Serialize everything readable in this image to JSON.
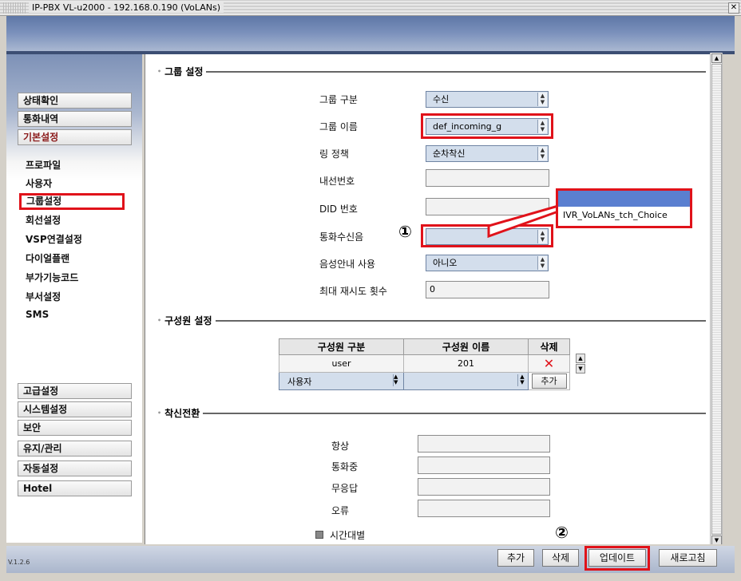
{
  "window": {
    "title": "IP-PBX VL-u2000 - 192.168.0.190 (VoLANs)",
    "close_glyph": "✕"
  },
  "sidebar": {
    "top_items": [
      {
        "label": "상태확인",
        "active": false
      },
      {
        "label": "통화내역",
        "active": false
      },
      {
        "label": "기본설정",
        "active": true
      }
    ],
    "sub_items": [
      {
        "label": "프로파일",
        "active": false
      },
      {
        "label": "사용자",
        "active": false
      },
      {
        "label": "그룹설정",
        "active": true
      },
      {
        "label": "회선설정",
        "active": false
      },
      {
        "label": "VSP연결설정",
        "active": false
      },
      {
        "label": "다이얼플랜",
        "active": false
      },
      {
        "label": "부가기능코드",
        "active": false
      },
      {
        "label": "부서설정",
        "active": false
      },
      {
        "label": "SMS",
        "active": false
      }
    ],
    "bottom_items": [
      {
        "label": "고급설정"
      },
      {
        "label": "시스템설정"
      },
      {
        "label": "보안"
      },
      {
        "label": "유지/관리"
      },
      {
        "label": "자동설정"
      },
      {
        "label": "Hotel"
      }
    ],
    "version": "V.1.2.6"
  },
  "group_settings": {
    "title": "그룹 설정",
    "group_type": {
      "label": "그룹 구분",
      "value": "수신"
    },
    "group_name": {
      "label": "그룹 이름",
      "value": "def_incoming_g"
    },
    "ring_policy": {
      "label": "링 정책",
      "value": "순차착신"
    },
    "extension": {
      "label": "내선번호",
      "value": ""
    },
    "did": {
      "label": "DID 번호",
      "value": ""
    },
    "ringtone": {
      "label": "통화수신음",
      "value": ""
    },
    "voice_guide": {
      "label": "음성안내 사용",
      "value": "아니오"
    },
    "max_retry": {
      "label": "최대 재시도 횟수",
      "value": "0"
    }
  },
  "ringtone_dropdown": {
    "options": [
      "",
      "IVR_VoLANs_tch_Choice"
    ]
  },
  "annotations": {
    "marker1": "①",
    "marker2": "②"
  },
  "members": {
    "title": "구성원 설정",
    "headers": [
      "구성원 구분",
      "구성원 이름",
      "삭제"
    ],
    "rows": [
      {
        "type": "user",
        "name": "201",
        "delete_glyph": "✕"
      }
    ],
    "new_row": {
      "type": "사용자",
      "name": "",
      "add_label": "추가"
    },
    "scroll_up": "▲",
    "scroll_down": "▼"
  },
  "forwarding": {
    "title": "착신전환",
    "fields": [
      {
        "label": "항상",
        "value": ""
      },
      {
        "label": "통화중",
        "value": ""
      },
      {
        "label": "무응답",
        "value": ""
      },
      {
        "label": "오류",
        "value": ""
      }
    ],
    "time_based": {
      "label": "시간대별",
      "checked": false
    }
  },
  "footer": {
    "add": "추가",
    "delete": "삭제",
    "update": "업데이트",
    "refresh": "새로고침"
  },
  "colors": {
    "highlight": "#e0121a",
    "header": "#6d83ad",
    "selection": "#5a7fd0"
  }
}
